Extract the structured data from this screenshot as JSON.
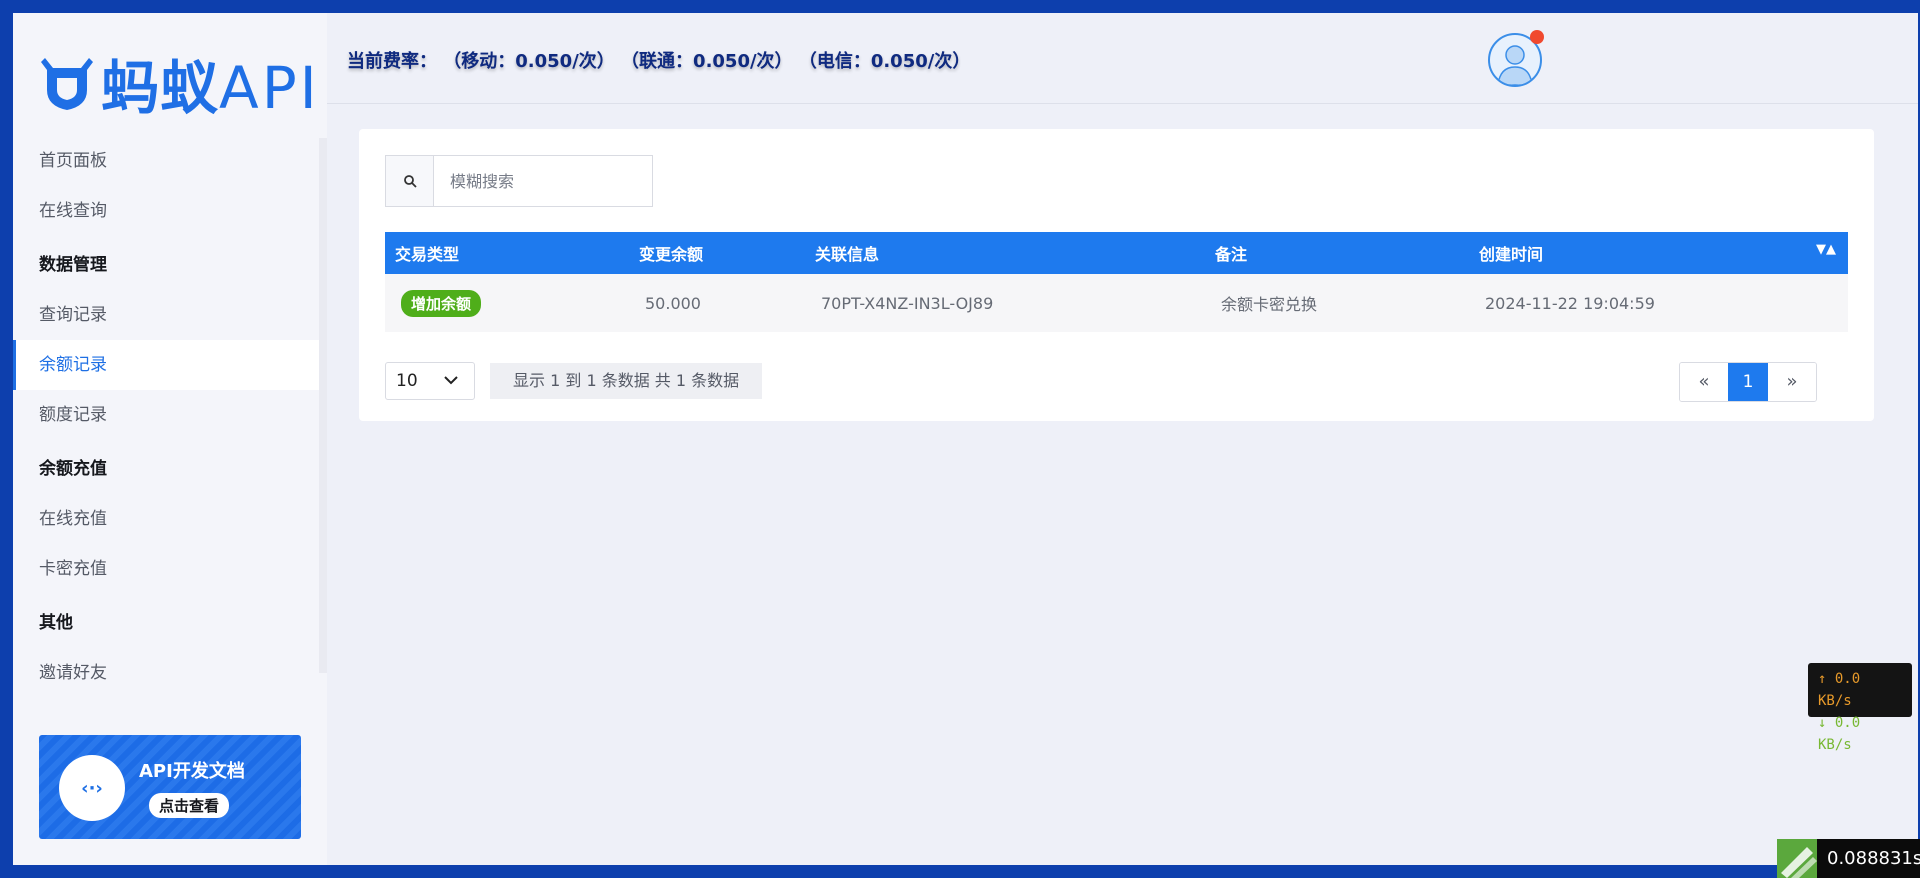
{
  "brand": {
    "logo_text": "蚂蚁",
    "logo_api": "API"
  },
  "sidebar": {
    "items": [
      {
        "type": "item",
        "label": "首页面板"
      },
      {
        "type": "item",
        "label": "在线查询"
      },
      {
        "type": "group",
        "label": "数据管理"
      },
      {
        "type": "item",
        "label": "查询记录"
      },
      {
        "type": "item",
        "label": "余额记录",
        "active": true
      },
      {
        "type": "item",
        "label": "额度记录"
      },
      {
        "type": "group",
        "label": "余额充值"
      },
      {
        "type": "item",
        "label": "在线充值"
      },
      {
        "type": "item",
        "label": "卡密充值"
      },
      {
        "type": "group",
        "label": "其他"
      },
      {
        "type": "item",
        "label": "邀请好友"
      }
    ],
    "doc_card": {
      "title": "API开发文档",
      "button": "点击查看",
      "icon": "code-icon"
    }
  },
  "header": {
    "rate_text": "当前费率： （移动：0.050/次） （联通：0.050/次） （电信：0.050/次）"
  },
  "search": {
    "placeholder": "模糊搜索",
    "value": ""
  },
  "table": {
    "columns": [
      "交易类型",
      "变更余额",
      "关联信息",
      "备注",
      "创建时间"
    ],
    "rows": [
      {
        "type": "增加余额",
        "amount": "50.000",
        "ref": "70PT-X4NZ-IN3L-OJ89",
        "note": "余额卡密兑换",
        "created": "2024-11-22 19:04:59"
      }
    ]
  },
  "pagination": {
    "page_size": "10",
    "info": "显示 1 到 1 条数据 共 1 条数据",
    "prev": "«",
    "current": "1",
    "next": "»"
  },
  "network": {
    "up": "↑ 0.0 KB/s",
    "down": "↓ 0.0 KB/s"
  },
  "timer": {
    "value": "0.088831s"
  },
  "colors": {
    "accent": "#1e7aee",
    "badge": "#4fae1a",
    "frame": "#0d3fad"
  }
}
